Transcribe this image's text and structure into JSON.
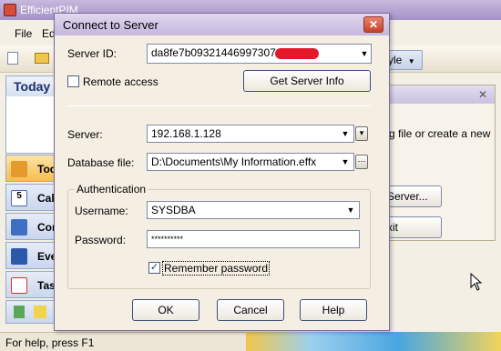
{
  "main": {
    "title": "EfficientPIM",
    "menu": [
      "File",
      "Ed"
    ],
    "style_button": "yle",
    "today_header": "Today",
    "nav_items": [
      "Tod",
      "Cal",
      "Cor",
      "Eve",
      "Tas"
    ],
    "right_panel": {
      "text": "g file or create a new",
      "button1": "Server...",
      "button2": "xit"
    },
    "status_text": "For help, press F1"
  },
  "dialog": {
    "title": "Connect to Server",
    "server_id_label": "Server ID:",
    "server_id_value": "da8fe7b09321446997307c2",
    "remote_access_label": "Remote access",
    "remote_access_checked": false,
    "get_server_info_button": "Get Server Info",
    "server_label": "Server:",
    "server_value": "192.168.1.128",
    "database_file_label": "Database file:",
    "database_file_value": "D:\\Documents\\My Information.effx",
    "auth_group_label": "Authentication",
    "username_label": "Username:",
    "username_value": "SYSDBA",
    "password_label": "Password:",
    "password_value": "**********",
    "remember_password_label": "Remember password",
    "remember_password_checked": true,
    "ok_button": "OK",
    "cancel_button": "Cancel",
    "help_button": "Help"
  },
  "colors": {
    "dialog_title_bar": "#c4b6dd",
    "dialog_background": "#f5efe3",
    "active_nav": "#f7bd52"
  },
  "icons": [
    "app-icon",
    "new-icon",
    "open-icon",
    "close-icon",
    "dropdown-arrow-icon",
    "browse-icon",
    "checkmark-icon"
  ]
}
